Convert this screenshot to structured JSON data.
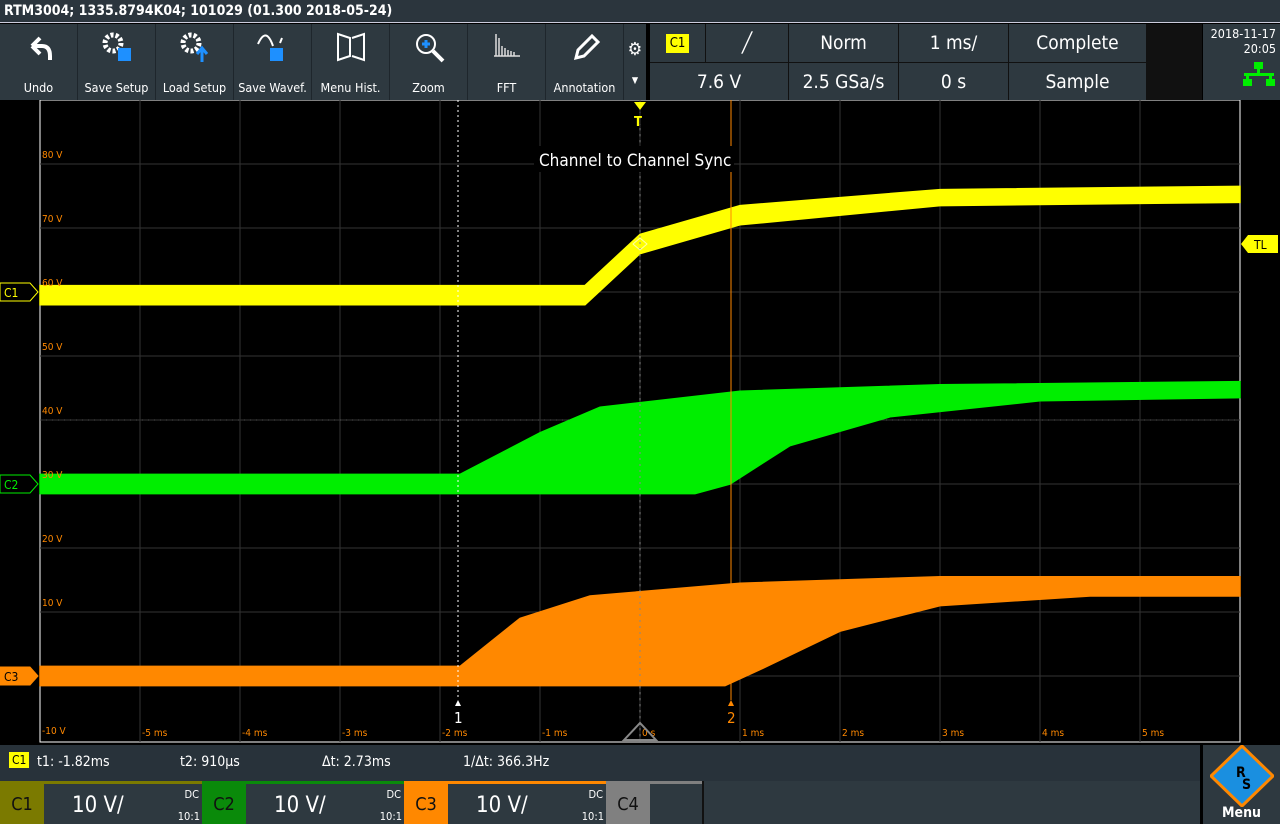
{
  "title": "RTM3004; 1335.8794K04; 101029 (01.300 2018-05-24)",
  "toolbar": [
    {
      "label": "Undo",
      "icon": "undo-icon"
    },
    {
      "label": "Save Setup",
      "icon": "save-setup-icon"
    },
    {
      "label": "Load Setup",
      "icon": "load-setup-icon"
    },
    {
      "label": "Save Wavef.",
      "icon": "save-waveform-icon"
    },
    {
      "label": "Menu Hist.",
      "icon": "menu-history-icon"
    },
    {
      "label": "Zoom",
      "icon": "zoom-icon"
    },
    {
      "label": "FFT",
      "icon": "fft-icon"
    },
    {
      "label": "Annotation",
      "icon": "pencil-icon"
    }
  ],
  "status": {
    "trig_source": "C1",
    "slope": "╱",
    "mode": "Norm",
    "timebase": "1 ms/",
    "acq": "Complete",
    "level": "7.6 V",
    "rate": "2.5 GSa/s",
    "offset": "0 s",
    "acq_mode": "Sample"
  },
  "datetime": {
    "date": "2018-11-17",
    "time": "20:05"
  },
  "plot": {
    "annotation": "Channel to Channel Sync",
    "trigger_marker": "T",
    "tl_label": "TL",
    "volt_labels": [
      "80 V",
      "70 V",
      "60 V",
      "50 V",
      "40 V",
      "30 V",
      "20 V",
      "10 V",
      "-10 V"
    ],
    "volt_values": [
      80,
      70,
      60,
      50,
      40,
      30,
      20,
      10,
      -10
    ],
    "time_labels": [
      "-5 ms",
      "-4 ms",
      "-3 ms",
      "-2 ms",
      "-1 ms",
      "0 s",
      "1 ms",
      "2 ms",
      "3 ms",
      "4 ms",
      "5 ms"
    ],
    "time_values": [
      -5,
      -4,
      -3,
      -2,
      -1,
      0,
      1,
      2,
      3,
      4,
      5
    ],
    "cursors": [
      {
        "label": "1",
        "t_ms": -1.82,
        "color": "#ffffff"
      },
      {
        "label": "2",
        "t_ms": 0.91,
        "color": "#ff8800"
      }
    ],
    "channels": [
      {
        "label": "C1",
        "color": "#ffff00",
        "marker_v": 60,
        "upper": [
          [
            -6,
            61
          ],
          [
            -0.55,
            61
          ],
          [
            0,
            69
          ],
          [
            1,
            73.5
          ],
          [
            3,
            76
          ],
          [
            6,
            76.5
          ]
        ],
        "lower": [
          [
            -6,
            58
          ],
          [
            -0.55,
            58
          ],
          [
            0,
            66
          ],
          [
            1,
            70.5
          ],
          [
            3,
            73.5
          ],
          [
            6,
            74
          ]
        ]
      },
      {
        "label": "C2",
        "color": "#00ee00",
        "marker_v": 30,
        "upper": [
          [
            -6,
            31.5
          ],
          [
            -1.8,
            31.5
          ],
          [
            -1,
            38
          ],
          [
            -0.4,
            42
          ],
          [
            1,
            44.5
          ],
          [
            3,
            45.5
          ],
          [
            6,
            46
          ]
        ],
        "lower": [
          [
            -6,
            28.5
          ],
          [
            0.55,
            28.5
          ],
          [
            0.9,
            30
          ],
          [
            1.5,
            36
          ],
          [
            2.5,
            40.5
          ],
          [
            4,
            43
          ],
          [
            6,
            43.5
          ]
        ]
      },
      {
        "label": "C3",
        "color": "#ff8800",
        "marker_v": 0,
        "upper": [
          [
            -6,
            1.5
          ],
          [
            -1.8,
            1.5
          ],
          [
            -1.2,
            9
          ],
          [
            -0.5,
            12.5
          ],
          [
            1,
            14.5
          ],
          [
            3,
            15.5
          ],
          [
            6,
            15.5
          ]
        ],
        "lower": [
          [
            -6,
            -1.5
          ],
          [
            0.85,
            -1.5
          ],
          [
            1.2,
            1
          ],
          [
            2,
            7
          ],
          [
            3,
            11
          ],
          [
            4.5,
            12.5
          ],
          [
            6,
            12.5
          ]
        ]
      }
    ]
  },
  "measure": {
    "source": "C1",
    "t1": "t1: -1.82ms",
    "t2": "t2: 910µs",
    "dt": "Δt: 2.73ms",
    "inv": "1/Δt: 366.3Hz"
  },
  "channels_bar": [
    {
      "label": "C1",
      "scale": "10 V/",
      "coupling": "DC",
      "probe": "10:1",
      "color": "#7b7a00"
    },
    {
      "label": "C2",
      "scale": "10 V/",
      "coupling": "DC",
      "probe": "10:1",
      "color": "#0a8a0a"
    },
    {
      "label": "C3",
      "scale": "10 V/",
      "coupling": "DC",
      "probe": "10:1",
      "color": "#ff8800"
    },
    {
      "label": "C4",
      "color": "#808080"
    }
  ],
  "menu": {
    "label": "Menu",
    "logo": "R&S"
  }
}
